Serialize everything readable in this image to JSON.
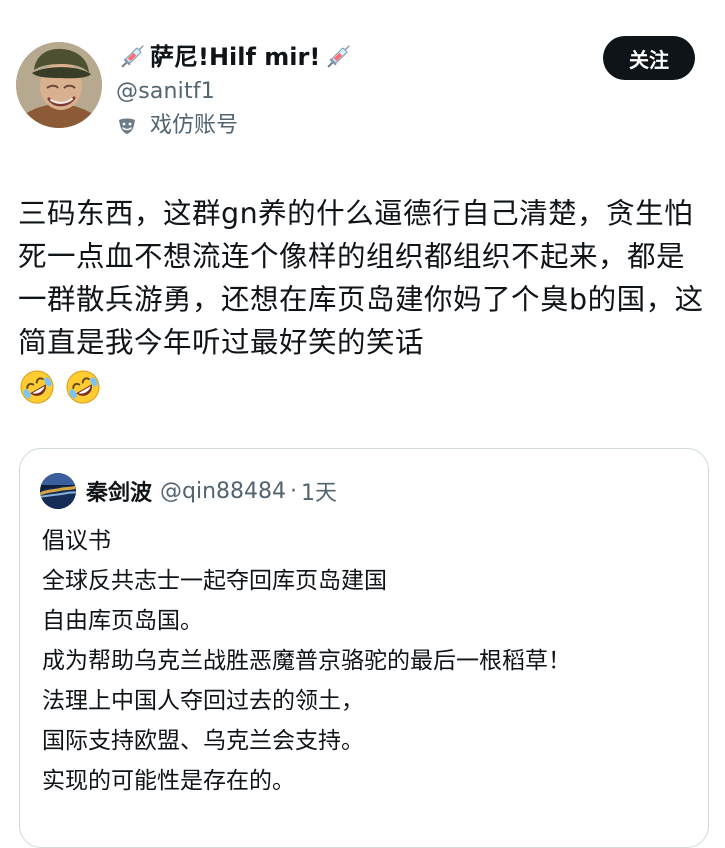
{
  "author": {
    "display_name": "萨尼!Hilf mir!",
    "display_name_decoration_icon": "syringe-emoji",
    "handle": "@sanitf1",
    "account_label": "戏仿账号",
    "account_label_icon": "mask-icon",
    "avatar_icon": "soldier-helmet-avatar"
  },
  "actions": {
    "follow_label": "关注"
  },
  "post": {
    "text": "三码东西，这群gn养的什么逼德行自己清楚，贪生怕死一点血不想流连个像样的组织都组织不起来，都是一群散兵游勇，还想在库页岛建你妈了个臭b的国，这简直是我今年听过最好笑的笑话",
    "trailing_emojis": [
      "rolling-on-the-floor-laughing-emoji",
      "rolling-on-the-floor-laughing-emoji"
    ]
  },
  "quoted_post": {
    "author_name": "秦剑波",
    "handle": "@qin88484",
    "separator": "·",
    "timestamp": "1天",
    "avatar_icon": "landscape-avatar",
    "lines": [
      "倡议书",
      "全球反共志士一起夺回库页岛建国",
      "自由库页岛国。",
      "成为帮助乌克兰战胜恶魔普京骆驼的最后一根稻草！",
      "法理上中国人夺回过去的领土，",
      "国际支持欧盟、乌克兰会支持。",
      "实现的可能性是存在的。"
    ]
  },
  "colors": {
    "text_primary": "#0f1419",
    "text_secondary": "#536471",
    "border": "#cfd9de",
    "follow_button_bg": "#0f1419",
    "follow_button_text": "#ffffff"
  }
}
